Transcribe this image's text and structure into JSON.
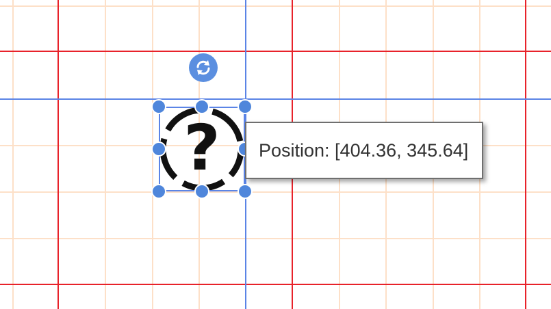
{
  "canvas": {
    "grid_minor_color": "#fde0c8",
    "grid_major_color": "#e8222a",
    "guide_color": "#5b84e6"
  },
  "shape": {
    "icon": "help-question-icon",
    "glyph": "?"
  },
  "rotate_handle": {
    "icon": "rotate-icon",
    "color": "#5b8fe0"
  },
  "selection": {
    "handle_color": "#4f86db"
  },
  "tooltip": {
    "text": "Position: [404.36, 345.64]"
  }
}
